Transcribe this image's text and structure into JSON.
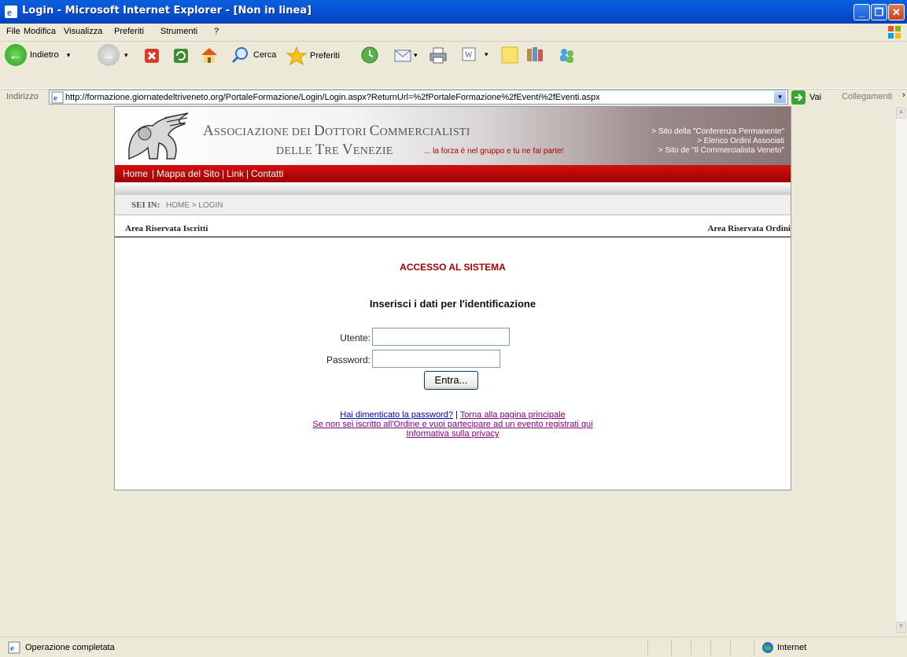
{
  "window": {
    "title": "Login - Microsoft Internet Explorer - [Non in linea]"
  },
  "menu": [
    "File",
    "Modifica",
    "Visualizza",
    "Preferiti",
    "Strumenti",
    "?"
  ],
  "toolbar": {
    "back_label": "Indietro",
    "search_label": "Cerca",
    "favorites_label": "Preferiti"
  },
  "address": {
    "label": "Indirizzo",
    "url": "http://formazione.giornatedeltriveneto.org/PortaleFormazione/Login/Login.aspx?ReturnUrl=%2fPortaleFormazione%2fEventi%2fEventi.aspx",
    "go_label": "Vai",
    "links_label": "Collegamenti"
  },
  "site": {
    "assoc_line1": [
      "A",
      "SSOCIAZIONE DEI ",
      "D",
      "OTTORI ",
      "C",
      "OMMERCIALISTI"
    ],
    "assoc_line2": [
      "DELLE ",
      "T",
      "RE ",
      "V",
      "ENEZIE"
    ],
    "slogan": "... la forza è nel gruppo e tu ne fai parte!",
    "ext_links": [
      "> Sito della \"Conferenza Permanente\"",
      "> Elenco Ordini Associati",
      "> Sito de \"Il Commercialista Veneto\""
    ],
    "nav": [
      "Home",
      "Mappa del Sito",
      "Link",
      "Contatti"
    ],
    "breadcrumb_label": "SEI IN:",
    "breadcrumb_path": "HOME > LOGIN",
    "area_left": "Area Riservata Iscritti",
    "area_right": "Area Riservata Ordini"
  },
  "login": {
    "heading": "ACCESSO AL SISTEMA",
    "subheading": "Inserisci i dati per l'identificazione",
    "user_label": "Utente:",
    "user_value": "",
    "password_label": "Password:",
    "password_value": "",
    "submit_label": "Entra..."
  },
  "links": {
    "forgot": "Hai dimenticato la password?",
    "separator": "|",
    "home": "Torna alla pagina principale",
    "register": "Se non sei iscritto all'Ordine e vuoi partecipare ad un evento registrati qui",
    "privacy": "Informativa sulla privacy"
  },
  "status": {
    "text": "Operazione completata",
    "zone": "Internet"
  }
}
